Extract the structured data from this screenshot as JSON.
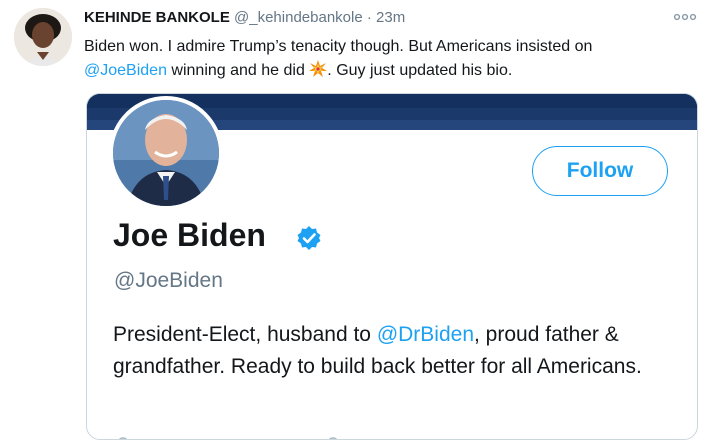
{
  "tweet": {
    "author_name": "KEHINDE BANKOLE",
    "author_handle": "@_kehindebankole",
    "separator": "·",
    "time": "23m",
    "more_icon": "more-dots-icon",
    "text_part1": "Biden won. I admire Trump’s tenacity though. But Americans insisted on",
    "text_mention": "@JoeBiden",
    "text_part2": " winning and he did ",
    "emoji": "collision-emoji",
    "text_part3": ". Guy just updated his bio."
  },
  "profile_card": {
    "banner_color": "#1b3a6b",
    "follow_label": "Follow",
    "name": "Joe Biden",
    "verified_icon": "verified-badge-icon",
    "handle": "@JoeBiden",
    "bio_part1": "President-Elect, husband to ",
    "bio_mention": "@DrBiden",
    "bio_part2": ", proud father & grandfather. Ready to build back better for all Americans."
  },
  "colors": {
    "accent": "#1da1f2",
    "text": "#14171a",
    "muted": "#657786",
    "border": "#ccd6dd"
  }
}
